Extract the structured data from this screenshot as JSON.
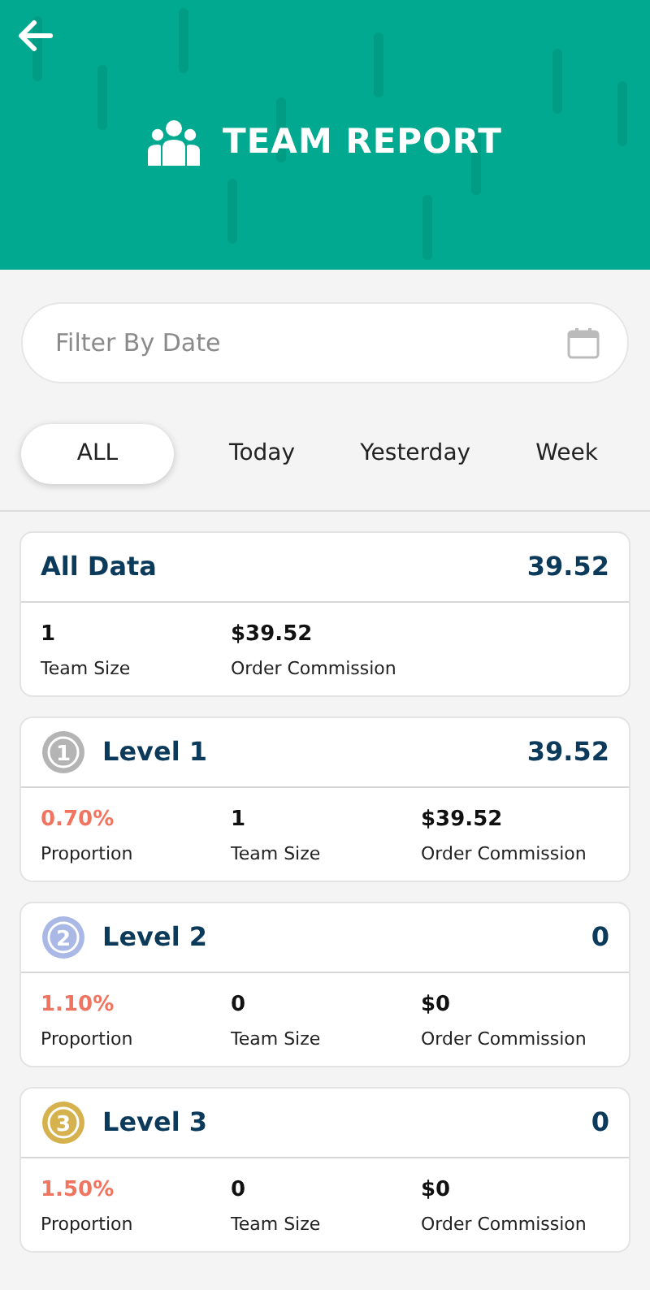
{
  "header": {
    "title": "TEAM REPORT"
  },
  "filter": {
    "placeholder": "Filter By Date"
  },
  "tabs": [
    {
      "label": "ALL",
      "selected": true
    },
    {
      "label": "Today",
      "selected": false
    },
    {
      "label": "Yesterday",
      "selected": false
    },
    {
      "label": "Week",
      "selected": false
    }
  ],
  "summary": {
    "title": "All Data",
    "total": "39.52",
    "stats": [
      {
        "value": "1",
        "label": "Team Size"
      },
      {
        "value": "$39.52",
        "label": "Order Commission"
      }
    ]
  },
  "levels": [
    {
      "medal": "1",
      "color": "#b4b4b4",
      "title": "Level 1",
      "total": "39.52",
      "proportion": "0.70%",
      "proportion_label": "Proportion",
      "team_size": "1",
      "team_size_label": "Team Size",
      "commission": "$39.52",
      "commission_label": "Order Commission"
    },
    {
      "medal": "2",
      "color": "#a9b8e4",
      "title": "Level 2",
      "total": "0",
      "proportion": "1.10%",
      "proportion_label": "Proportion",
      "team_size": "0",
      "team_size_label": "Team Size",
      "commission": "$0",
      "commission_label": "Order Commission"
    },
    {
      "medal": "3",
      "color": "#d6b24e",
      "title": "Level 3",
      "total": "0",
      "proportion": "1.50%",
      "proportion_label": "Proportion",
      "team_size": "0",
      "team_size_label": "Team Size",
      "commission": "$0",
      "commission_label": "Order Commission"
    }
  ]
}
